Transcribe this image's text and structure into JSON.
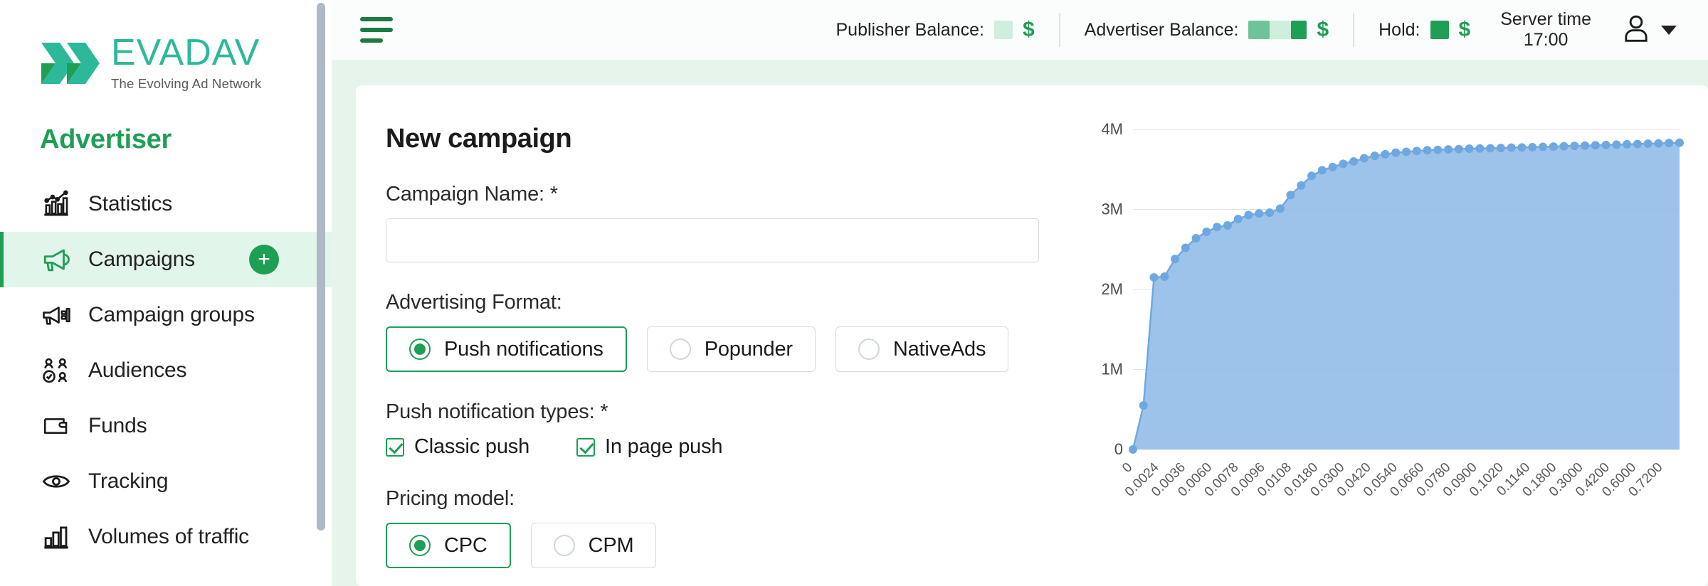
{
  "brand": {
    "logo_word": "EVADAV",
    "logo_tagline": "The Evolving Ad Network",
    "accent_green": "#1f9e55",
    "logo_teal": "#2cb99a"
  },
  "sidebar": {
    "role_title": "Advertiser",
    "items": [
      {
        "label": "Statistics",
        "icon": "statistics-chart-icon",
        "active": false
      },
      {
        "label": "Campaigns",
        "icon": "megaphone-icon",
        "active": true,
        "add_button": "+"
      },
      {
        "label": "Campaign groups",
        "icon": "megaphone-group-icon",
        "active": false
      },
      {
        "label": "Audiences",
        "icon": "audiences-people-icon",
        "active": false
      },
      {
        "label": "Funds",
        "icon": "wallet-icon",
        "active": false
      },
      {
        "label": "Tracking",
        "icon": "eye-icon",
        "active": false
      },
      {
        "label": "Volumes of traffic",
        "icon": "bar-chart-icon",
        "active": false
      }
    ]
  },
  "topbar": {
    "menu_icon": "hamburger-menu-icon",
    "publisher_balance_label": "Publisher Balance:",
    "advertiser_balance_label": "Advertiser Balance:",
    "hold_label": "Hold:",
    "currency_symbol": "$",
    "server_time_label": "Server time",
    "server_time_value": "17:00",
    "account_icon": "user-avatar-icon",
    "account_caret": "chevron-down-icon"
  },
  "form": {
    "title": "New campaign",
    "campaign_name_label": "Campaign Name: *",
    "campaign_name_value": "",
    "campaign_name_placeholder": "",
    "advertising_format_label": "Advertising Format:",
    "formats": [
      {
        "label": "Push notifications",
        "selected": true
      },
      {
        "label": "Popunder",
        "selected": false
      },
      {
        "label": "NativeAds",
        "selected": false
      }
    ],
    "push_types_label": "Push notification types: *",
    "push_types": [
      {
        "label": "Classic push",
        "checked": true
      },
      {
        "label": "In page push",
        "checked": true
      }
    ],
    "pricing_model_label": "Pricing model:",
    "pricing_models": [
      {
        "label": "CPC",
        "selected": true
      },
      {
        "label": "CPM",
        "selected": false
      }
    ]
  },
  "chart_data": {
    "type": "area",
    "title": "",
    "xlabel": "",
    "ylabel": "",
    "grid": true,
    "legend": "none",
    "line_color": "#6fa8e0",
    "fill_color": "#8cb8e8",
    "ylim": [
      0,
      4000000
    ],
    "ytick_labels": [
      "0",
      "1M",
      "2M",
      "3M",
      "4M"
    ],
    "ytick_values": [
      0,
      1000000,
      2000000,
      3000000,
      4000000
    ],
    "categories": [
      "0",
      "0.0024",
      "0.0036",
      "0.0060",
      "0.0078",
      "0.0096",
      "0.0108",
      "0.0180",
      "0.0300",
      "0.0420",
      "0.0540",
      "0.0660",
      "0.0780",
      "0.0900",
      "0.1020",
      "0.1140",
      "0.1800",
      "0.3000",
      "0.4200",
      "0.6000",
      "0.7200"
    ],
    "x": [
      0,
      0.0024,
      0.0036,
      0.006,
      0.0078,
      0.0096,
      0.0108,
      0.018,
      0.03,
      0.042,
      0.054,
      0.066,
      0.078,
      0.09,
      0.102,
      0.114,
      0.18,
      0.3,
      0.42,
      0.6,
      0.72
    ],
    "values": [
      0,
      550000,
      2150000,
      2160000,
      2380000,
      2520000,
      2640000,
      2770000,
      2790000,
      2870000,
      2950000,
      3000000,
      3020000,
      3080000,
      3220000,
      3350000,
      3450000,
      3530000,
      3580000,
      3620000,
      3650000
    ],
    "points": [
      {
        "x": 0,
        "y": 0
      },
      {
        "x": 1,
        "y": 550000
      },
      {
        "x": 2,
        "y": 2150000
      },
      {
        "x": 3,
        "y": 2160000
      },
      {
        "x": 4,
        "y": 2380000
      },
      {
        "x": 5,
        "y": 2520000
      },
      {
        "x": 6,
        "y": 2640000
      },
      {
        "x": 7,
        "y": 2720000
      },
      {
        "x": 8,
        "y": 2780000
      },
      {
        "x": 9,
        "y": 2800000
      },
      {
        "x": 10,
        "y": 2880000
      },
      {
        "x": 11,
        "y": 2930000
      },
      {
        "x": 12,
        "y": 2950000
      },
      {
        "x": 13,
        "y": 2960000
      },
      {
        "x": 14,
        "y": 3010000
      },
      {
        "x": 15,
        "y": 3180000
      },
      {
        "x": 16,
        "y": 3300000
      },
      {
        "x": 17,
        "y": 3420000
      },
      {
        "x": 18,
        "y": 3490000
      },
      {
        "x": 19,
        "y": 3530000
      },
      {
        "x": 20,
        "y": 3570000
      },
      {
        "x": 21,
        "y": 3600000
      },
      {
        "x": 22,
        "y": 3640000
      },
      {
        "x": 23,
        "y": 3670000
      },
      {
        "x": 24,
        "y": 3690000
      },
      {
        "x": 25,
        "y": 3710000
      },
      {
        "x": 26,
        "y": 3720000
      },
      {
        "x": 27,
        "y": 3730000
      },
      {
        "x": 28,
        "y": 3740000
      },
      {
        "x": 29,
        "y": 3745000
      },
      {
        "x": 30,
        "y": 3750000
      },
      {
        "x": 31,
        "y": 3755000
      },
      {
        "x": 32,
        "y": 3760000
      },
      {
        "x": 33,
        "y": 3762000
      },
      {
        "x": 34,
        "y": 3765000
      },
      {
        "x": 35,
        "y": 3768000
      },
      {
        "x": 36,
        "y": 3772000
      },
      {
        "x": 37,
        "y": 3775000
      },
      {
        "x": 38,
        "y": 3778000
      },
      {
        "x": 39,
        "y": 3782000
      },
      {
        "x": 40,
        "y": 3786000
      },
      {
        "x": 41,
        "y": 3790000
      },
      {
        "x": 42,
        "y": 3794000
      },
      {
        "x": 43,
        "y": 3798000
      },
      {
        "x": 44,
        "y": 3802000
      },
      {
        "x": 45,
        "y": 3806000
      },
      {
        "x": 46,
        "y": 3810000
      },
      {
        "x": 47,
        "y": 3814000
      },
      {
        "x": 48,
        "y": 3818000
      },
      {
        "x": 49,
        "y": 3822000
      },
      {
        "x": 50,
        "y": 3826000
      },
      {
        "x": 51,
        "y": 3830000
      },
      {
        "x": 52,
        "y": 3834000
      }
    ]
  }
}
